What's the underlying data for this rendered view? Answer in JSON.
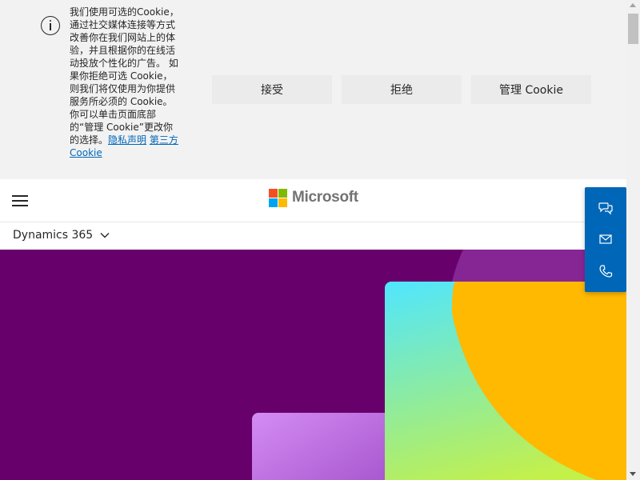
{
  "cookie_banner": {
    "icon": "info-icon",
    "text": "我们使用可选的Cookie，通过社交媒体连接等方式改善你在我们网站上的体验，并且根据你的在线活动投放个性化的广告。 如果你拒绝可选 Cookie，则我们将仅使用为你提供服务所必须的 Cookie。你可以单击页面底部的“管理 Cookie”更改你的选择。",
    "privacy_link": "隐私声明",
    "third_party_link": "第三方 Cookie",
    "accept_label": "接受",
    "reject_label": "拒绝",
    "manage_label": "管理 Cookie"
  },
  "header": {
    "menu_icon": "hamburger-icon",
    "logo_text": "Microsoft",
    "logo_colors": [
      "#f25022",
      "#7fba00",
      "#00a4ef",
      "#ffb900"
    ]
  },
  "subnav": {
    "label": "Dynamics 365",
    "icon": "chevron-down-icon"
  },
  "contact_panel": {
    "color": "#0067b8",
    "icons": [
      "chat-icon",
      "mail-icon",
      "phone-icon"
    ]
  },
  "hero": {
    "background_color": "#68006c",
    "accent_colors": [
      "#ffb900",
      "#50e6ff",
      "#c4f04a",
      "#c87ee8",
      "#8a2a9a"
    ]
  }
}
